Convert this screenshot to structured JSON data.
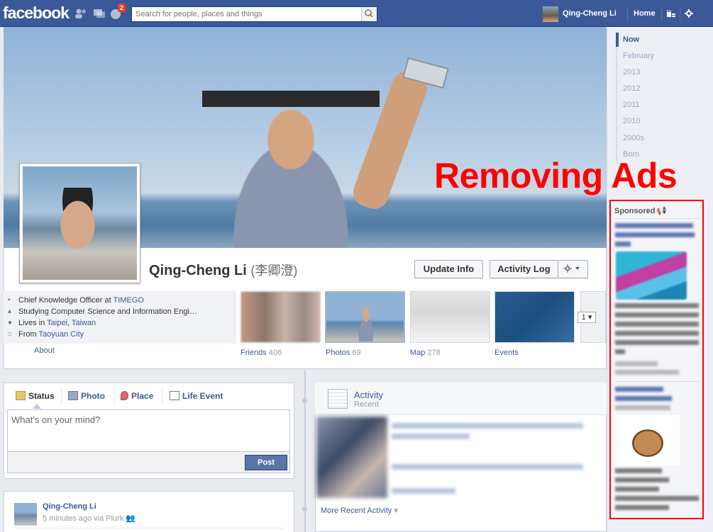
{
  "topbar": {
    "logo": "facebook",
    "notification_count": "2",
    "search_placeholder": "Search for people, places and things",
    "user_name": "Qing-Cheng Li",
    "home_label": "Home"
  },
  "profile": {
    "name": "Qing-Cheng Li",
    "name_alt": "(李卿澄)",
    "buttons": {
      "update_info": "Update Info",
      "activity_log": "Activity Log"
    },
    "info": {
      "work_prefix": "Chief Knowledge Officer at ",
      "work_link": "TIMEGO",
      "study": "Studying Computer Science and Information Engi…",
      "lives_prefix": "Lives in ",
      "lives_city": "Taipei",
      "lives_sep": ", ",
      "lives_country": "Taiwan",
      "from_prefix": "From ",
      "from_city": "Taoyuan City"
    },
    "about_label": "About",
    "apps": [
      {
        "label": "Friends",
        "count": "406"
      },
      {
        "label": "Photos",
        "count": "69"
      },
      {
        "label": "Map",
        "count": "278"
      },
      {
        "label": "Events",
        "count": ""
      }
    ],
    "pager_value": "1"
  },
  "composer": {
    "tabs": [
      "Status",
      "Photo",
      "Place",
      "Life Event"
    ],
    "placeholder": "What's on your mind?",
    "post_button": "Post"
  },
  "post": {
    "author": "Qing-Cheng Li",
    "meta": "5 minutes ago via Plurk"
  },
  "activity": {
    "title": "Activity",
    "subtitle": "Recent",
    "more_link": "More Recent Activity"
  },
  "scrubber": {
    "items": [
      "Now",
      "February",
      "2013",
      "2012",
      "2011",
      "2010",
      "2000s",
      "Born"
    ]
  },
  "overlay": {
    "caption": "Removing Ads"
  },
  "ads": {
    "header": "Sponsored",
    "annotation_color": "#ff0000"
  },
  "colors": {
    "brand": "#3b5998",
    "link": "#3b5998",
    "annotation": "#ff0000"
  }
}
